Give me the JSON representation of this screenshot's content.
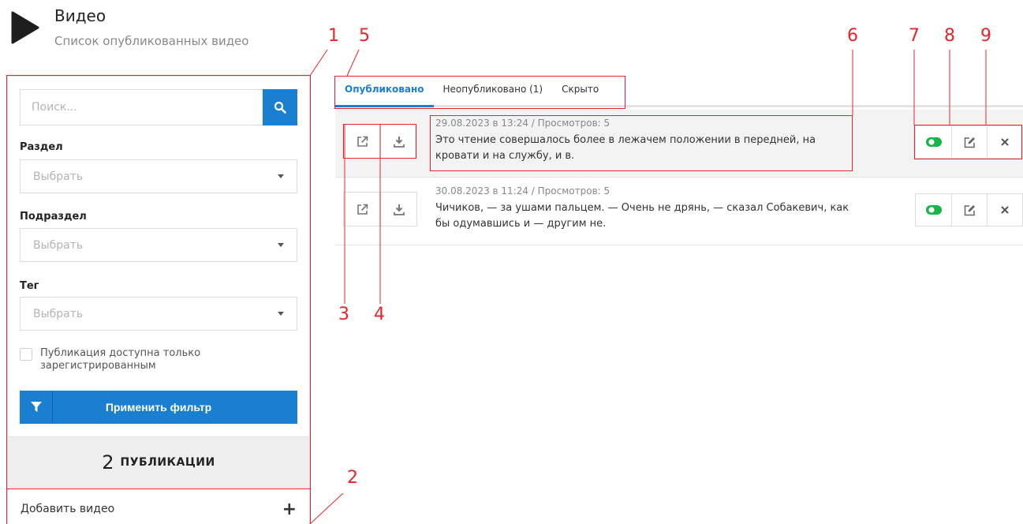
{
  "header": {
    "title": "Видео",
    "subtitle": "Список опубликованных видео"
  },
  "sidebar": {
    "search": {
      "placeholder": "Поиск...",
      "value": ""
    },
    "section_label": "Раздел",
    "section_select": "Выбрать",
    "subsection_label": "Подраздел",
    "subsection_select": "Выбрать",
    "tag_label": "Тег",
    "tag_select": "Выбрать",
    "checkbox_label": "Публикация доступна только зарегистрированным",
    "apply_label": "Применить фильтр",
    "count_number": "2",
    "count_word": "ПУБЛИКАЦИИ",
    "add_label": "Добавить видео",
    "add_icon": "+"
  },
  "tabs": [
    {
      "label": "Опубликовано",
      "active": true
    },
    {
      "label": "Неопубликовано (1)",
      "active": false
    },
    {
      "label": "Скрыто",
      "active": false
    }
  ],
  "videos": [
    {
      "meta": "29.08.2023 в 13:24 / Просмотров: 5",
      "text": "Это чтение совершалось более в лежачем положении в передней, на кровати и на службу, и в."
    },
    {
      "meta": "30.08.2023 в 11:24 / Просмотров: 5",
      "text": "Чичиков, — за ушами пальцем. — Очень не дрянь, — сказал Собакевич, как бы одумавшись и — другим не."
    }
  ],
  "callouts": [
    "1",
    "2",
    "3",
    "4",
    "5",
    "6",
    "7",
    "8",
    "9"
  ],
  "colors": {
    "accent": "#1a7fd1",
    "toggle_on": "#16b548",
    "annotation": "#e8242a"
  },
  "icons": [
    "play-icon",
    "search-icon",
    "chevron-down-icon",
    "filter-icon",
    "plus-icon",
    "external-link-icon",
    "download-icon",
    "toggle-icon",
    "edit-icon",
    "close-icon"
  ]
}
